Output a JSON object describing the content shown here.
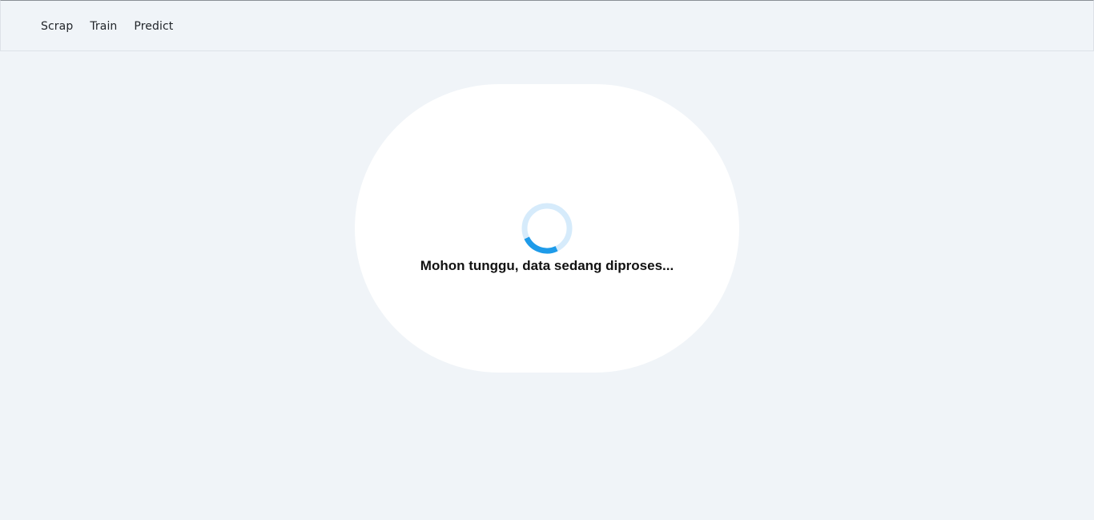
{
  "nav": {
    "items": [
      {
        "label": "Scrap"
      },
      {
        "label": "Train"
      },
      {
        "label": "Predict"
      }
    ]
  },
  "loader": {
    "message": "Mohon tunggu, data sedang diproses...",
    "icon": "spinner-icon",
    "track_color": "#d6ebfb",
    "arc_color": "#1e9be9"
  },
  "colors": {
    "page_background": "#f0f4f8",
    "card_background": "#ffffff",
    "text": "#111111"
  }
}
